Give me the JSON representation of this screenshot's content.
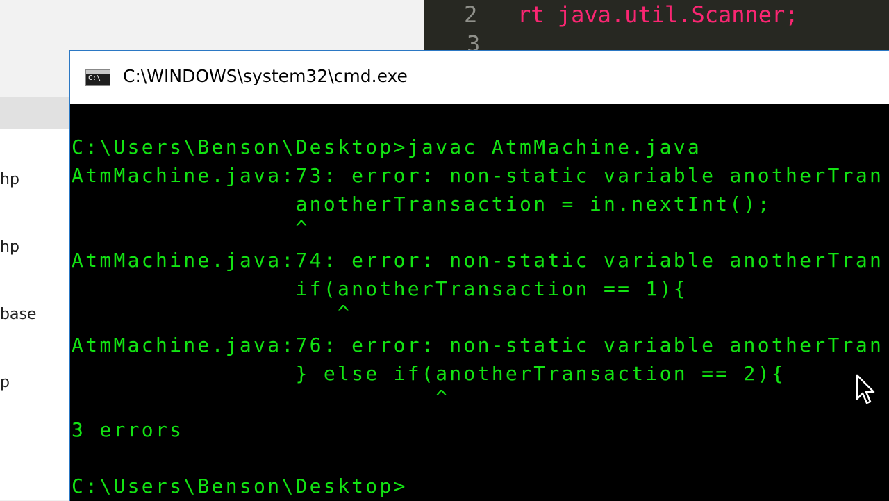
{
  "background": {
    "left_list_items": [
      "hp",
      "hp",
      "base",
      "p"
    ],
    "editor": {
      "line_numbers": [
        "2",
        "3"
      ],
      "code_line": {
        "keyword_fragment": "rt",
        "rest": " java.util.Scanner;"
      }
    }
  },
  "cmd": {
    "title": "C:\\WINDOWS\\system32\\cmd.exe",
    "icon_glyph": "C:\\",
    "lines": [
      "C:\\Users\\Benson\\Desktop>javac AtmMachine.java",
      "AtmMachine.java:73: error: non-static variable anotherTran",
      "                anotherTransaction = in.nextInt();",
      "                ^",
      "AtmMachine.java:74: error: non-static variable anotherTran",
      "                if(anotherTransaction == 1){",
      "                   ^",
      "AtmMachine.java:76: error: non-static variable anotherTran",
      "                } else if(anotherTransaction == 2){",
      "                          ^",
      "3 errors",
      "",
      "C:\\Users\\Benson\\Desktop>"
    ]
  },
  "colors": {
    "terminal_text": "#13e313",
    "terminal_bg": "#000000",
    "editor_bg": "#272822",
    "editor_keyword": "#f92672"
  }
}
